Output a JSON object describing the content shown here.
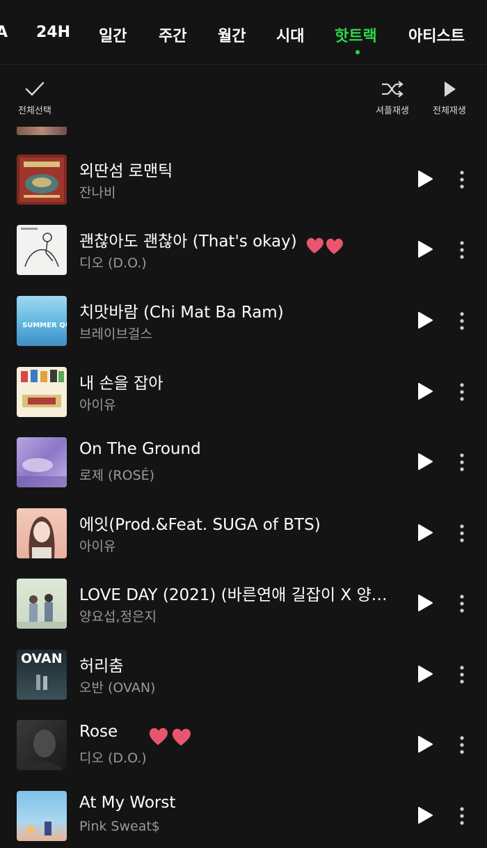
{
  "tabs": [
    {
      "label": "A",
      "active": false
    },
    {
      "label": "24H",
      "active": false
    },
    {
      "label": "일간",
      "active": false
    },
    {
      "label": "주간",
      "active": false
    },
    {
      "label": "월간",
      "active": false
    },
    {
      "label": "시대",
      "active": false
    },
    {
      "label": "핫트랙",
      "active": true
    },
    {
      "label": "아티스트",
      "active": false
    }
  ],
  "colors": {
    "accent": "#2bd94a",
    "background": "#141414",
    "heart": "#e8566e"
  },
  "toolbar": {
    "select_all_label": "전체선택",
    "shuffle_label": "셔플재생",
    "play_all_label": "전체재생"
  },
  "songs": [
    {
      "title": "외딴섬 로맨틱",
      "artist": "잔나비",
      "hearts": false
    },
    {
      "title": "괜찮아도 괜찮아 (That's okay)",
      "artist": "디오 (D.O.)",
      "hearts": true
    },
    {
      "title": "치맛바람 (Chi Mat Ba Ram)",
      "artist": "브레이브걸스",
      "hearts": false,
      "cover_text": "SUMMER QUEEN"
    },
    {
      "title": "내 손을 잡아",
      "artist": "아이유",
      "hearts": false
    },
    {
      "title": "On The Ground",
      "artist": "로제 (ROSÉ)",
      "hearts": false
    },
    {
      "title": "에잇(Prod.&Feat. SUGA of BTS)",
      "artist": "아이유",
      "hearts": false
    },
    {
      "title": "LOVE DAY (2021) (바른연애 길잡이 X 양…",
      "artist": "양요섭,정은지",
      "hearts": false
    },
    {
      "title": "허리춤",
      "artist": "오반 (OVAN)",
      "hearts": false,
      "cover_text": "OVAN"
    },
    {
      "title": "Rose",
      "artist": "디오 (D.O.)",
      "hearts": true
    },
    {
      "title": "At My Worst",
      "artist": "Pink Sweat$",
      "hearts": false
    }
  ]
}
